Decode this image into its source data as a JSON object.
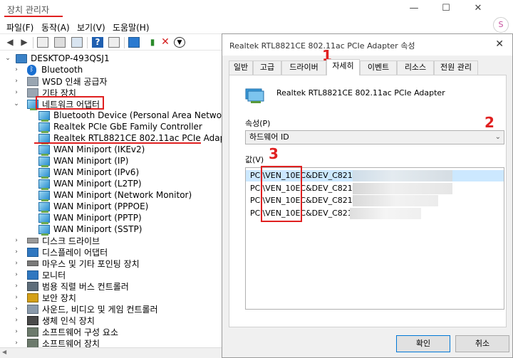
{
  "window": {
    "title": "장치 관리자",
    "minimize": "—",
    "maximize": "☐",
    "close": "✕",
    "avatar_letter": "S"
  },
  "menu": [
    "파일(F)",
    "동작(A)",
    "보기(V)",
    "도움말(H)"
  ],
  "tree": {
    "root": "DESKTOP-493QSJ1",
    "categories": [
      {
        "label": "Bluetooth",
        "icon": "bluetooth-icon"
      },
      {
        "label": "WSD 인쇄 공급자",
        "icon": "printer-icon"
      },
      {
        "label": "기타 장치",
        "icon": "unknown-device-icon"
      },
      {
        "label": "네트워크 어댑터",
        "icon": "network-adapter-icon"
      }
    ],
    "network_children": [
      "Bluetooth Device (Personal Area Network)",
      "Realtek PCIe GbE Family Controller",
      "Realtek RTL8821CE 802.11ac PCIe Adapter",
      "WAN Miniport (IKEv2)",
      "WAN Miniport (IP)",
      "WAN Miniport (IPv6)",
      "WAN Miniport (L2TP)",
      "WAN Miniport (Network Monitor)",
      "WAN Miniport (PPPOE)",
      "WAN Miniport (PPTP)",
      "WAN Miniport (SSTP)"
    ],
    "more_categories": [
      "디스크 드라이브",
      "디스플레이 어댑터",
      "마우스 및 기타 포인팅 장치",
      "모니터",
      "범용 직렬 버스 컨트롤러",
      "보안 장치",
      "사운드, 비디오 및 게임 컨트롤러",
      "생체 인식 장치",
      "소프트웨어 구성 요소",
      "소프트웨어 장치"
    ]
  },
  "dialog": {
    "title": "Realtek RTL8821CE 802.11ac PCIe Adapter 속성",
    "close": "✕",
    "tabs": [
      "일반",
      "고급",
      "드라이버",
      "자세히",
      "이벤트",
      "리소스",
      "전원 관리"
    ],
    "selected_tab": "자세히",
    "device_name": "Realtek RTL8821CE 802.11ac PCIe Adapter",
    "property_label": "속성(P)",
    "property_value": "하드웨어 ID",
    "value_label": "값(V)",
    "values": [
      "PCI\\VEN_10EC&DEV_C821&",
      "PCI\\VEN_10EC&DEV_C821&",
      "PCI\\VEN_10EC&DEV_C821&",
      "PCI\\VEN_10EC&DEV_C821&"
    ],
    "ok_label": "확인",
    "cancel_label": "취소"
  },
  "annotations": [
    "1",
    "2",
    "3"
  ],
  "colors": {
    "accent_red": "#e02020",
    "selection": "#cce8ff"
  }
}
